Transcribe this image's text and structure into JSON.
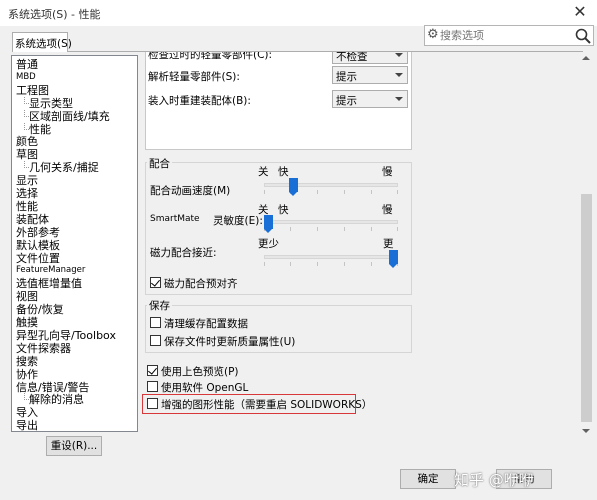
{
  "window": {
    "title": "系统选项(S) - 性能",
    "close_glyph": "✕"
  },
  "tab": {
    "label": "系统选项(S)"
  },
  "search": {
    "placeholder": "搜索选项"
  },
  "tree": {
    "items": [
      {
        "label": "普通",
        "indent": 0
      },
      {
        "label": "MBD",
        "indent": 0,
        "small": true
      },
      {
        "label": "工程图",
        "indent": 0
      },
      {
        "label": "显示类型",
        "indent": 1
      },
      {
        "label": "区域剖面线/填充",
        "indent": 1
      },
      {
        "label": "性能",
        "indent": 1
      },
      {
        "label": "颜色",
        "indent": 0
      },
      {
        "label": "草图",
        "indent": 0
      },
      {
        "label": "几何关系/捕捉",
        "indent": 1
      },
      {
        "label": "显示",
        "indent": 0
      },
      {
        "label": "选择",
        "indent": 0
      },
      {
        "label": "性能",
        "indent": 0
      },
      {
        "label": "装配体",
        "indent": 0
      },
      {
        "label": "外部参考",
        "indent": 0
      },
      {
        "label": "默认模板",
        "indent": 0
      },
      {
        "label": "文件位置",
        "indent": 0
      },
      {
        "label": "FeatureManager",
        "indent": 0,
        "small": true
      },
      {
        "label": "选值框增量值",
        "indent": 0
      },
      {
        "label": "视图",
        "indent": 0
      },
      {
        "label": "备份/恢复",
        "indent": 0
      },
      {
        "label": "触摸",
        "indent": 0
      },
      {
        "label": "异型孔向导/Toolbox",
        "indent": 0
      },
      {
        "label": "文件探索器",
        "indent": 0
      },
      {
        "label": "搜索",
        "indent": 0
      },
      {
        "label": "协作",
        "indent": 0
      },
      {
        "label": "信息/错误/警告",
        "indent": 0
      },
      {
        "label": "解除的消息",
        "indent": 1
      },
      {
        "label": "导入",
        "indent": 0
      },
      {
        "label": "导出",
        "indent": 0
      }
    ]
  },
  "reset_button": "重设(R)...",
  "panel": {
    "truncated_label": "检查过时的轻量零部件(C):",
    "truncated_value": "不检查",
    "resolve_label": "解析轻量零部件(S):",
    "resolve_value": "提示",
    "rebuild_label": "装入时重建装配体(B):",
    "rebuild_value": "提示",
    "mate_group": {
      "title": "配合",
      "anim_label": "配合动画速度(M)",
      "anim_left": "关",
      "anim_mid": "快",
      "anim_right": "慢",
      "anim_value": 0.2,
      "sens_label_prefix": "SmartMate",
      "sens_label": "灵敏度(E):",
      "sens_left": "关",
      "sens_mid": "快",
      "sens_right": "慢",
      "sens_value": 0.0,
      "snap_label": "磁力配合接近:",
      "snap_left": "更少",
      "snap_right": "更",
      "snap_value": 1.0,
      "preselect_label": "磁力配合预对齐",
      "preselect_checked": true
    },
    "save_group": {
      "title": "保存",
      "purge_label": "清理缓存配置数据",
      "purge_checked": false,
      "update_label": "保存文件时更新质量属性(U)",
      "update_checked": false
    },
    "shaded_label": "使用上色预览(P)",
    "shaded_checked": true,
    "opengl_label": "使用软件 OpenGL",
    "opengl_checked": false,
    "enhanced_label": "增强的图形性能（需要重启 SOLIDWORKS）",
    "enhanced_checked": false
  },
  "buttons": {
    "ok": "确定",
    "help": "帮助"
  },
  "watermark": "知乎 @咿咿",
  "colors": {
    "slider_thumb": "#1a6fd6",
    "highlight_box": "#d9383a"
  }
}
